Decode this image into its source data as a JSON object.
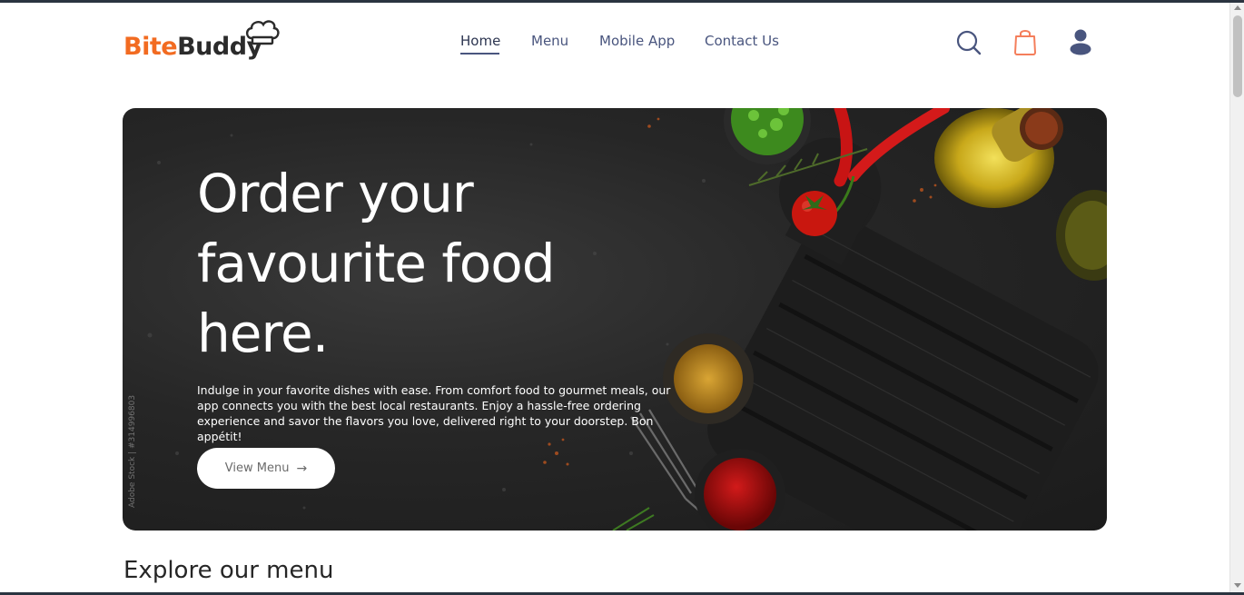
{
  "brand": {
    "name_part1": "Bite",
    "name_part2": "Buddy",
    "colors": {
      "accent": "#f26b21",
      "dark": "#2b2b2b",
      "nav": "#49557e"
    }
  },
  "nav": {
    "items": [
      {
        "label": "Home",
        "active": true
      },
      {
        "label": "Menu",
        "active": false
      },
      {
        "label": "Mobile App",
        "active": false
      },
      {
        "label": "Contact Us",
        "active": false
      }
    ]
  },
  "header_icons": {
    "search": "search-icon",
    "cart": "shopping-bag-icon",
    "profile": "user-icon"
  },
  "hero": {
    "title": "Order your favourite food here.",
    "description": "Indulge in your favorite dishes with ease. From comfort food to gourmet meals, our app connects you with the best local restaurants. Enjoy a hassle-free ordering experience and savor the flavors you love, delivered right to your doorstep. Bon appétit!",
    "button_label": "View Menu",
    "button_arrow": "→",
    "watermark": "Adobe Stock | #314996803"
  },
  "section": {
    "explore_title": "Explore our menu"
  }
}
